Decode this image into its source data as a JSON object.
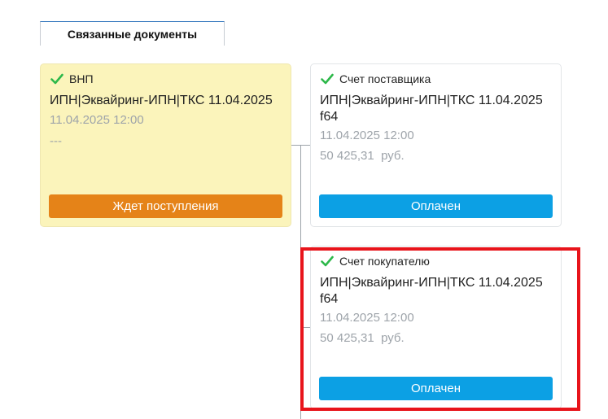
{
  "tab": {
    "label": "Связанные документы"
  },
  "cards": [
    {
      "title": "ВНП",
      "name": "ИПН|Эквайринг-ИПН|ТКС 11.04.2025",
      "date": "11.04.2025 12:00",
      "extra": "---",
      "status": "Ждет поступления",
      "status_color": "#e58318"
    },
    {
      "title": "Счет поставщика",
      "name_line1": "ИПН|Эквайринг-ИПН|ТКС 11.04.2025",
      "name_line2": "f64",
      "date": "11.04.2025 12:00",
      "amount": "50 425,31",
      "currency": "руб.",
      "status": "Оплачен",
      "status_color": "#0ca0e4"
    },
    {
      "title": "Счет покупателю",
      "name_line1": "ИПН|Эквайринг-ИПН|ТКС 11.04.2025",
      "name_line2": "f64",
      "date": "11.04.2025 12:00",
      "amount": "50 425,31",
      "currency": "руб.",
      "status": "Оплачен",
      "status_color": "#0ca0e4"
    }
  ],
  "icons": {
    "check": "check-icon"
  },
  "colors": {
    "check": "#2db84a",
    "highlight": "#e8141b"
  }
}
